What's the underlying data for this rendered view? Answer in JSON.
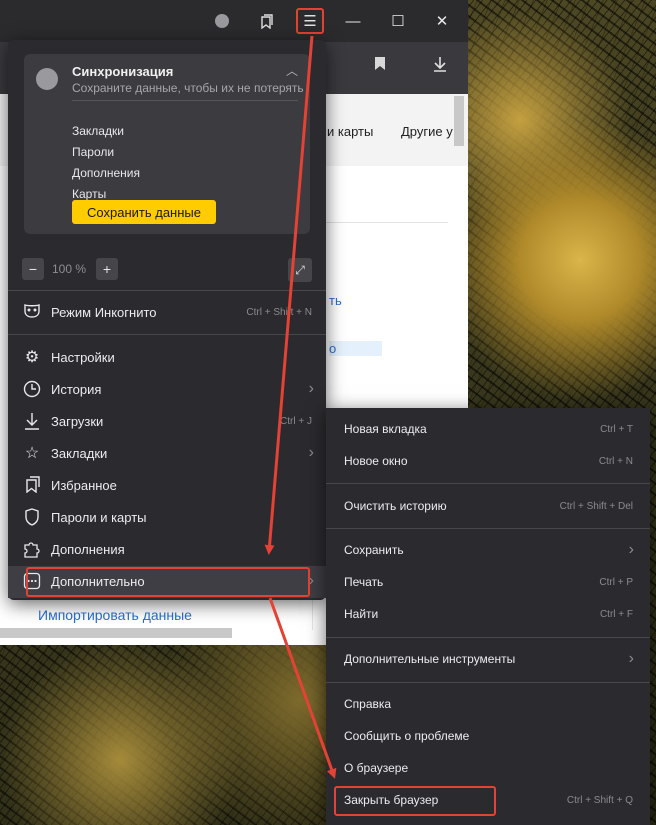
{
  "window": {
    "controls": {
      "minimize": "—",
      "maximize": "☐",
      "close": "✕"
    },
    "menu_icon": "☰"
  },
  "page": {
    "bookmarks_bar": [
      "и карты",
      "Другие у"
    ],
    "link_fragments": [
      "ть",
      "о"
    ],
    "import_link": "Импортировать данные"
  },
  "menu": {
    "sync": {
      "title": "Синхронизация",
      "subtitle": "Сохраните данные, чтобы их не потерять",
      "items": [
        "Закладки",
        "Пароли",
        "Дополнения",
        "Карты"
      ],
      "button": "Сохранить данные"
    },
    "zoom": {
      "minus": "−",
      "value": "100 %",
      "plus": "+"
    },
    "incognito": {
      "label": "Режим Инкогнито",
      "shortcut": "Ctrl + Shift + N",
      "icon": "mask-icon"
    },
    "items": [
      {
        "label": "Настройки",
        "icon": "gear-icon",
        "shortcut": "",
        "submenu": false
      },
      {
        "label": "История",
        "icon": "clock-icon",
        "shortcut": "",
        "submenu": true
      },
      {
        "label": "Загрузки",
        "icon": "download-icon",
        "shortcut": "Ctrl + J",
        "submenu": false
      },
      {
        "label": "Закладки",
        "icon": "star-icon",
        "shortcut": "",
        "submenu": true
      },
      {
        "label": "Избранное",
        "icon": "collections-icon",
        "shortcut": "",
        "submenu": false
      },
      {
        "label": "Пароли и карты",
        "icon": "key-icon",
        "shortcut": "",
        "submenu": false
      },
      {
        "label": "Дополнения",
        "icon": "puzzle-icon",
        "shortcut": "",
        "submenu": false
      },
      {
        "label": "Дополнительно",
        "icon": "more-icon",
        "shortcut": "",
        "submenu": true
      }
    ]
  },
  "submenu": {
    "items": [
      {
        "label": "Новая вкладка",
        "shortcut": "Ctrl + T"
      },
      {
        "label": "Новое окно",
        "shortcut": "Ctrl + N"
      },
      {
        "label": "Очистить историю",
        "shortcut": "Ctrl + Shift + Del"
      },
      {
        "label": "Сохранить",
        "shortcut": ""
      },
      {
        "label": "Печать",
        "shortcut": "Ctrl + P"
      },
      {
        "label": "Найти",
        "shortcut": "Ctrl + F"
      },
      {
        "label": "Дополнительные инструменты",
        "shortcut": ""
      },
      {
        "label": "Справка",
        "shortcut": ""
      },
      {
        "label": "Сообщить о проблеме",
        "shortcut": ""
      },
      {
        "label": "О браузере",
        "shortcut": ""
      },
      {
        "label": "Закрыть браузер",
        "shortcut": "Ctrl + Shift + Q"
      }
    ]
  },
  "colors": {
    "highlight": "#e34234",
    "menu_bg": "#2b2b2f",
    "accent_yellow": "#ffcc00",
    "link": "#2a6fcf"
  }
}
